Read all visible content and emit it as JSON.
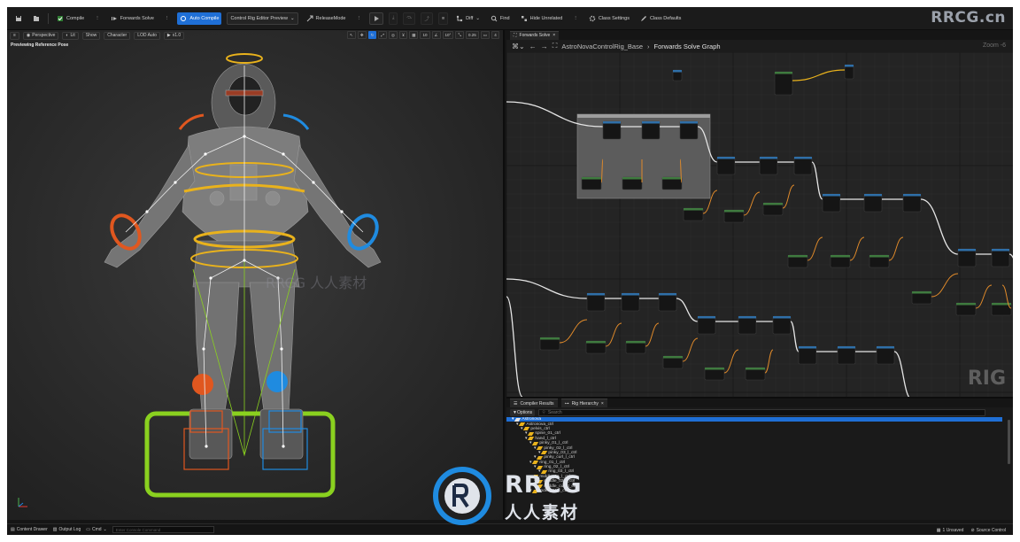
{
  "toolbar": {
    "compile": "Compile",
    "forwards_solve": "Forwards Solve",
    "auto_compile": "Auto Compile",
    "preview": "Control Rig Editor Preview",
    "release_mode": "ReleaseMode",
    "diff": "Diff",
    "find": "Find",
    "hide_unrelated": "Hide Unrelated",
    "class_settings": "Class Settings",
    "class_defaults": "Class Defaults"
  },
  "watermark_top": "RRCG.cn",
  "viewport": {
    "perspective": "Perspective",
    "lit": "Lit",
    "show": "Show",
    "character": "Character",
    "lod": "LOD Auto",
    "speed": "x1.0",
    "tools": [
      "10",
      "10°",
      "0.25",
      "4"
    ],
    "status_label": "Previewing Reference Pose",
    "watermark1": "RRCG",
    "watermark2": "人人素材"
  },
  "graph": {
    "tab": "Forwards Solve",
    "asset": "AstroNovaControlRig_Base",
    "current": "Forwards Solve Graph",
    "zoom": "Zoom -6",
    "watermark": "RIG"
  },
  "hierarchy": {
    "tabs": [
      "Compiler Results",
      "Rig Hierarchy"
    ],
    "options": "Options",
    "search_placeholder": "Search",
    "items": [
      {
        "label": "Astronova",
        "depth": 0,
        "kind": "bone",
        "selected": true
      },
      {
        "label": "Astronova_ctrl",
        "depth": 1,
        "kind": "ctrl"
      },
      {
        "label": "pelvis_ctrl",
        "depth": 2,
        "kind": "ctrl"
      },
      {
        "label": "spine_01_ctrl",
        "depth": 3,
        "kind": "ctrl"
      },
      {
        "label": "hand_l_ctrl",
        "depth": 3,
        "kind": "ctrl"
      },
      {
        "label": "pinky_01_l_ctrl",
        "depth": 4,
        "kind": "ctrl"
      },
      {
        "label": "pinky_02_l_ctrl",
        "depth": 5,
        "kind": "ctrl"
      },
      {
        "label": "pinky_03_l_ctrl",
        "depth": 6,
        "kind": "ctrl"
      },
      {
        "label": "pinky_curl_l_ctrl",
        "depth": 5,
        "kind": "ctrl"
      },
      {
        "label": "ring_01_l_ctrl",
        "depth": 4,
        "kind": "ctrl"
      },
      {
        "label": "ring_02_l_ctrl",
        "depth": 5,
        "kind": "ctrl"
      },
      {
        "label": "ring_03_l_ctrl",
        "depth": 6,
        "kind": "ctrl"
      },
      {
        "label": "middle_01_l_ctrl",
        "depth": 4,
        "kind": "ctrl"
      },
      {
        "label": "middle_02_l_ctrl",
        "depth": 5,
        "kind": "ctrl"
      },
      {
        "label": "middle_curl_l_ctrl",
        "depth": 5,
        "kind": "ctrl"
      },
      {
        "label": "index_01_l_ctrl",
        "depth": 4,
        "kind": "ctrl"
      }
    ]
  },
  "status": {
    "content_drawer": "Content Drawer",
    "output_log": "Output Log",
    "cmd": "Cmd",
    "console_placeholder": "Enter Console Command",
    "unsaved": "1 Unsaved",
    "source_control": "Source Control"
  },
  "logo": {
    "line1": "RRCG",
    "line2": "人人素材"
  },
  "colors": {
    "accent": "#1f6fd6",
    "orange": "#e0571f",
    "blue": "#1f8be0",
    "yellow": "#e9b21c",
    "green": "#7bd11f",
    "exec_wire": "#e6e6e6",
    "data_wire": "#e08a2a"
  }
}
